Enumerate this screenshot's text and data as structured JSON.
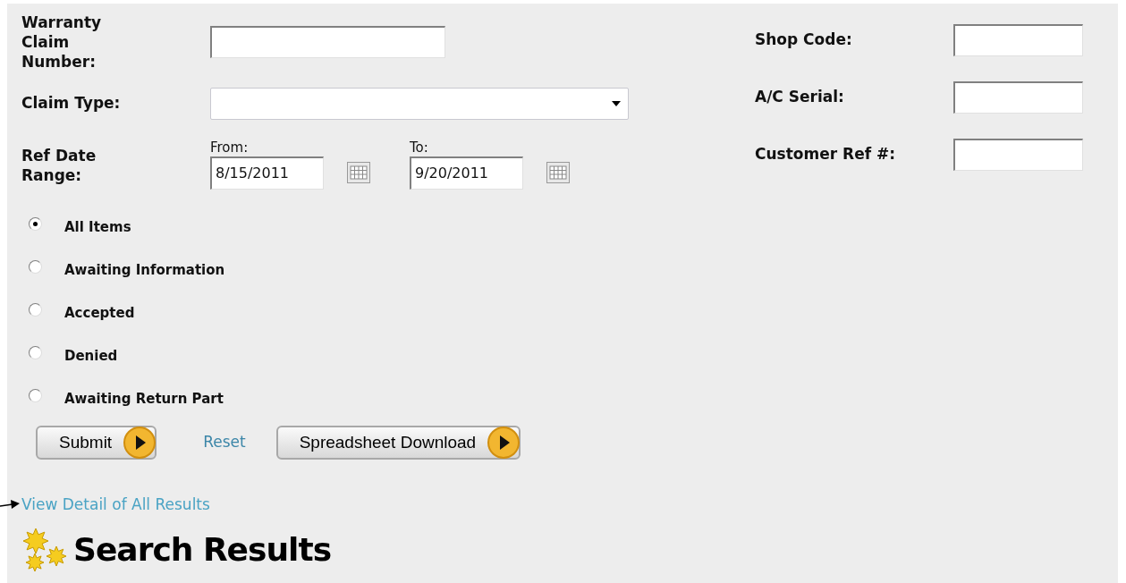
{
  "fields": {
    "claim_number": {
      "label": "Warranty Claim Number:"
    },
    "claim_type": {
      "label": "Claim Type:"
    },
    "ref_date_range": {
      "label": "Ref Date Range:",
      "from_label": "From:",
      "from_value": "8/15/2011",
      "to_label": "To:",
      "to_value": "9/20/2011"
    }
  },
  "right_fields": [
    {
      "label": "Shop Code:"
    },
    {
      "label": "A/C Serial:"
    },
    {
      "label": "Customer Ref #:"
    }
  ],
  "status_options": [
    {
      "label": "All Items",
      "selected": true
    },
    {
      "label": "Awaiting Information",
      "selected": false
    },
    {
      "label": "Accepted",
      "selected": false
    },
    {
      "label": "Denied",
      "selected": false
    },
    {
      "label": "Awaiting Return Part",
      "selected": false
    }
  ],
  "buttons": {
    "submit": "Submit",
    "reset": "Reset",
    "download": "Spreadsheet Download"
  },
  "view_detail_link": "View Detail of All Results",
  "section_title": "Search Results"
}
